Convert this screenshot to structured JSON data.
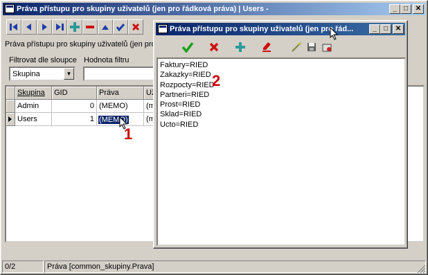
{
  "main_window": {
    "title": "Práva přístupu pro skupiny uživatelů (jen pro řádková práva) | Users -",
    "description": "Práva přístupu pro skupiny uživatelů (jen pro ř",
    "filter_column_label": "Filtrovat dle sloupce",
    "filter_column_value": "Skupina",
    "filter_value_label": "Hodnota filtru",
    "filter_value": "",
    "grid": {
      "columns": [
        "Skupina",
        "GID",
        "Práva",
        "Už"
      ],
      "rows": [
        {
          "skupina": "Admin",
          "gid": "0",
          "prava": "(MEMO)",
          "uz": "(m"
        },
        {
          "skupina": "Users",
          "gid": "1",
          "prava": "(MEMO)",
          "uz": "(m"
        }
      ]
    },
    "status": {
      "record": "0/2",
      "field": "Práva [common_skupiny.Prava]"
    }
  },
  "editor_window": {
    "title": "Práva přístupu pro skupiny uživatelů (jen pro řád...",
    "lines": [
      "Faktury=RIED",
      "Zakazky=RIED",
      "Rozpocty=RIED",
      "Partneri=RIED",
      "Prost=RIED",
      "Sklad=RIED",
      "Ucto=RIED"
    ]
  },
  "annotations": {
    "one": "1",
    "two": "2"
  },
  "colors": {
    "title_active": "#0a246a",
    "selection": "#0a246a",
    "annotation": "#cc0000",
    "icon_blue": "#1c3ea8",
    "icon_red": "#cc1010",
    "icon_green": "#18a018"
  }
}
